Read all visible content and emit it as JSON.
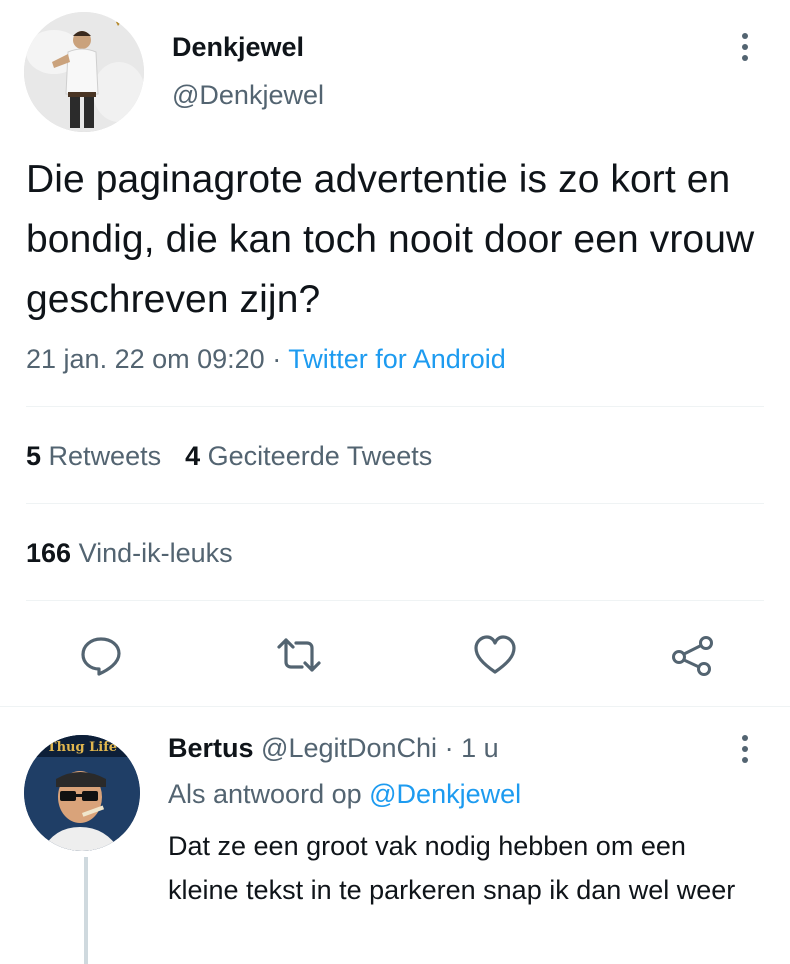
{
  "tweet": {
    "display_name": "Denkjewel",
    "handle": "@Denkjewel",
    "text": "Die paginagrote advertentie is zo kort en bondig, die kan toch nooit door een vrouw geschreven zijn?",
    "timestamp": "21 jan. 22 om 09:20",
    "separator": " · ",
    "source": "Twitter for Android",
    "more_icon": "more-vertical-icon"
  },
  "stats": {
    "retweets_count": "5",
    "retweets_label": "Retweets",
    "quotes_count": "4",
    "quotes_label": "Geciteerde Tweets",
    "likes_count": "166",
    "likes_label": "Vind-ik-leuks"
  },
  "actions": [
    {
      "icon": "reply-icon"
    },
    {
      "icon": "retweet-icon"
    },
    {
      "icon": "like-icon"
    },
    {
      "icon": "share-icon"
    }
  ],
  "reply": {
    "display_name": "Bertus",
    "handle": "@LegitDonChi",
    "time": "1 u",
    "separator": " · ",
    "replying_to_prefix": "Als antwoord op",
    "replying_to_handle": "@Denkjewel",
    "text": "Dat ze een groot vak nodig hebben om een kleine tekst in te parkeren snap ik dan wel weer",
    "avatar_text": "Thug Life"
  },
  "colors": {
    "text_primary": "#0f1419",
    "text_secondary": "#536471",
    "accent": "#1d9bf0",
    "divider": "#eff3f4"
  }
}
